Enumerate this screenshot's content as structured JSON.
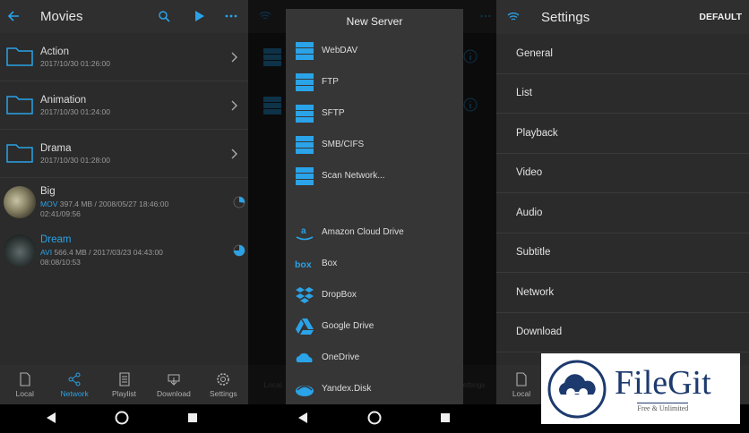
{
  "colors": {
    "accent": "#2aa3e8",
    "panel_bg": "#2b2b2b",
    "dialog_bg": "#363636",
    "logo_navy": "#1d3a6e"
  },
  "movies": {
    "title": "Movies",
    "items": [
      {
        "name": "Action",
        "meta": "2017/10/30 01:26:00",
        "icon": "folder-icon"
      },
      {
        "name": "Animation",
        "meta": "2017/10/30 01:24:00",
        "icon": "folder-icon"
      },
      {
        "name": "Drama",
        "meta": "2017/10/30 01:28:00",
        "icon": "folder-icon"
      }
    ],
    "videos": [
      {
        "name": "Big",
        "format": "MOV",
        "meta": " 397.4 MB / 2008/05/27 18:46:00",
        "time": "02:41/09:56",
        "progress": 0.27
      },
      {
        "name": "Dream",
        "format": "AVI",
        "meta": " 566.4 MB / 2017/03/23 04:43:00",
        "time": "08:08/10:53",
        "progress": 0.75
      }
    ]
  },
  "nav": {
    "local": "Local",
    "network": "Network",
    "playlist": "Playlist",
    "download": "Download",
    "settings": "Settings"
  },
  "dialog": {
    "title": "New Server",
    "servers": [
      "WebDAV",
      "FTP",
      "SFTP",
      "SMB/CIFS",
      "Scan Network..."
    ],
    "cloud": [
      "Amazon Cloud Drive",
      "Box",
      "DropBox",
      "Google Drive",
      "OneDrive",
      "Yandex.Disk"
    ]
  },
  "settings": {
    "title": "Settings",
    "default_label": "DEFAULT",
    "items": [
      "General",
      "List",
      "Playback",
      "Video",
      "Audio",
      "Subtitle",
      "Network",
      "Download"
    ]
  },
  "logo": {
    "brand": "FileGit",
    "tagline": "Free & Unlimited"
  }
}
